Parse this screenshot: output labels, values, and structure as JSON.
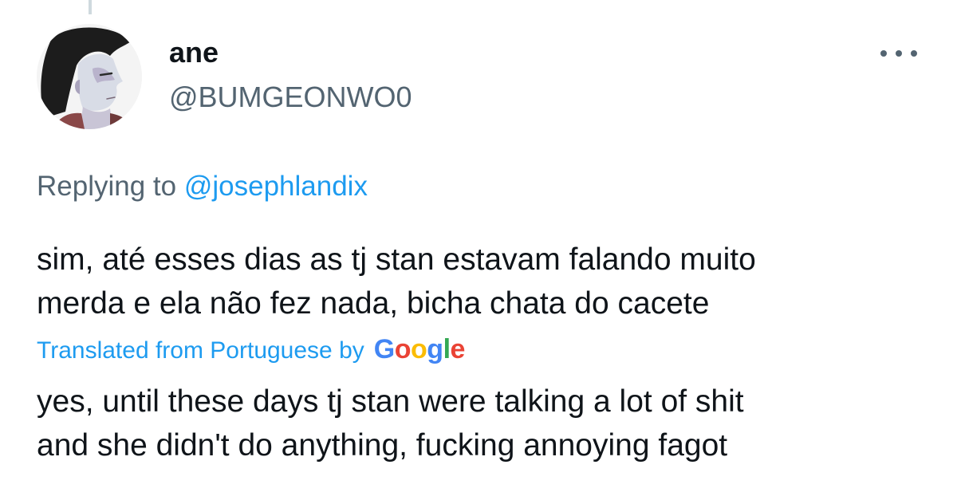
{
  "author": {
    "display_name": "ane",
    "handle": "@BUMGEONWO0"
  },
  "reply": {
    "prefix": "Replying to",
    "mention": "@josephlandix"
  },
  "tweet": {
    "text_line1": "sim, até esses dias as tj stan estavam falando muito",
    "text_line2": "merda e ela não fez nada, bicha chata do cacete"
  },
  "translation": {
    "label": "Translated from Portuguese by",
    "provider_letters": [
      "G",
      "o",
      "o",
      "g",
      "l",
      "e"
    ],
    "text_line1": "yes, until these days tj stan were talking a lot of shit",
    "text_line2": "and she didn't do anything, fucking annoying fagot"
  },
  "icons": {
    "more": "more-horizontal-icon",
    "avatar": "profile-avatar-image"
  },
  "colors": {
    "link": "#1d9bf0",
    "secondary_text": "#536471",
    "primary_text": "#0f1419"
  }
}
